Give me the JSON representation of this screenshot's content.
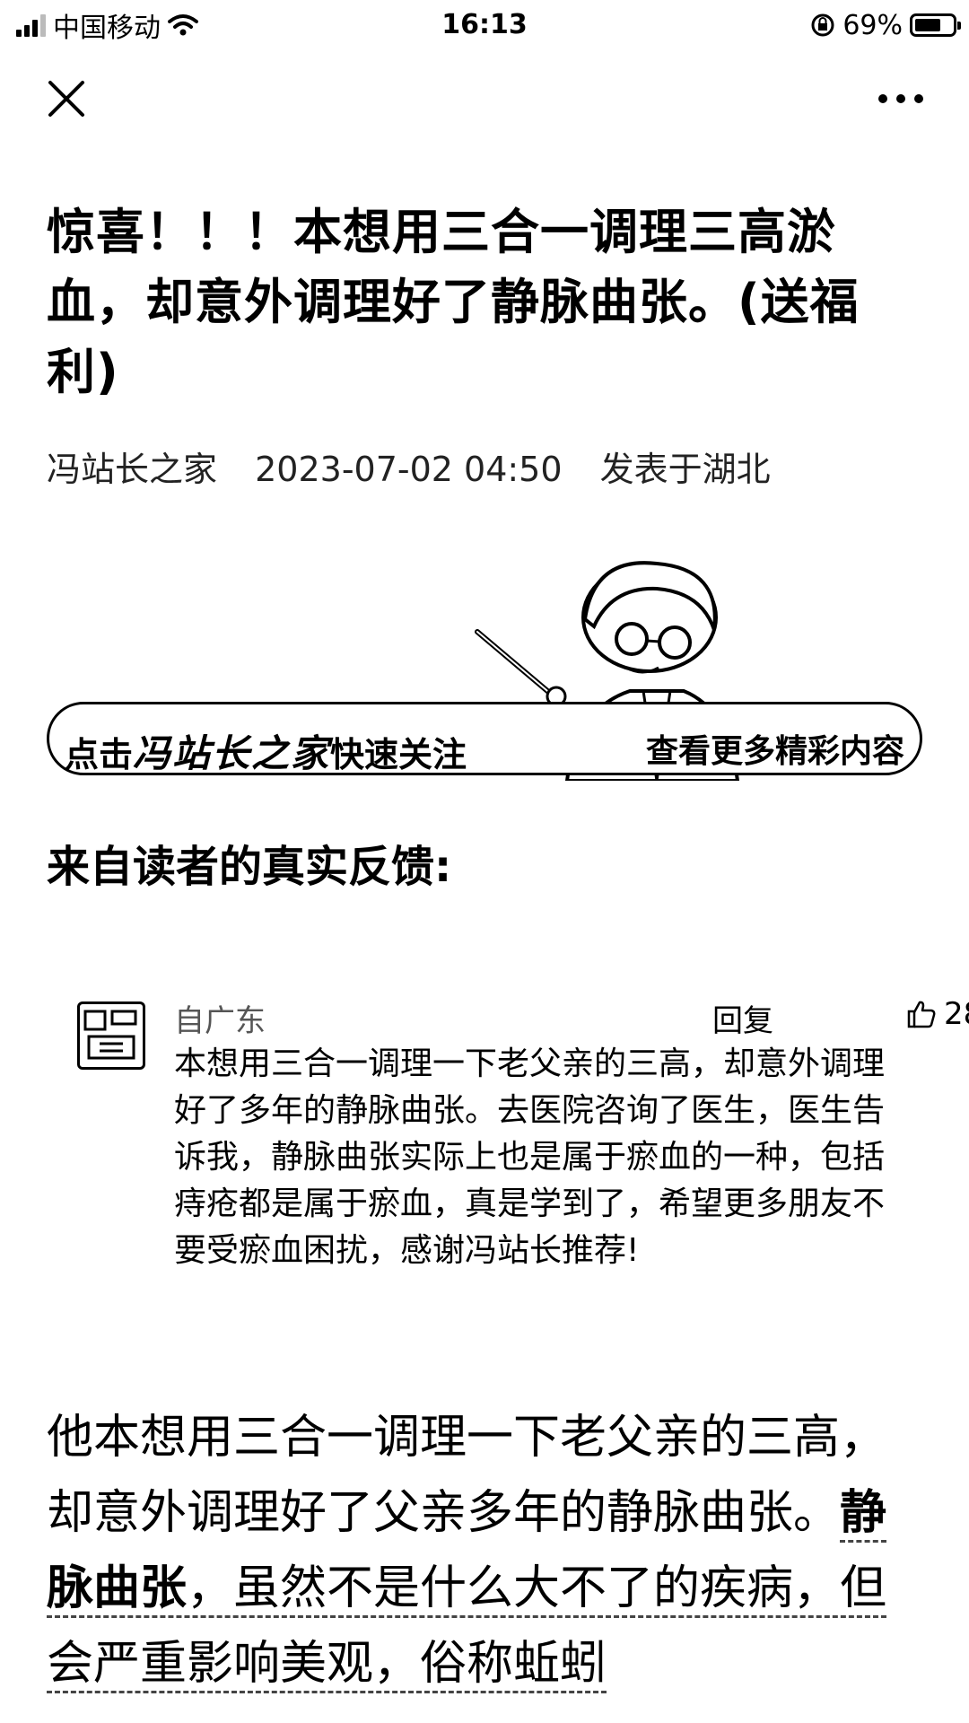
{
  "status_bar": {
    "carrier": "中国移动",
    "time": "16:13",
    "battery": "69%",
    "battery_level": 0.69
  },
  "nav": {
    "close_icon": "close-icon",
    "more_icon": "more-icon"
  },
  "article": {
    "title": "惊喜！！！本想用三合一调理三高淤血，却意外调理好了静脉曲张。(送福利)",
    "author": "冯站长之家",
    "datetime": "2023-07-02 04:50",
    "location": "发表于湖北"
  },
  "banner": {
    "left_prefix": "点击",
    "brand": "冯站长之家",
    "left_suffix": "快速关注",
    "right_text": "查看更多精彩内容"
  },
  "section_heading": "来自读者的真实反馈:",
  "comment": {
    "user_location": "自广东",
    "reply_label": "回复",
    "likes": "28",
    "text": "本想用三合一调理一下老父亲的三高，却意外调理好了多年的静脉曲张。去医院咨询了医生，医生告诉我，静脉曲张实际上也是属于瘀血的一种，包括痔疮都是属于瘀血，真是学到了，希望更多朋友不要受瘀血困扰，感谢冯站长推荐!"
  },
  "body": {
    "p1_start": "他本想用三合一调理一下老父亲的三高，却意外调理好了父亲多年的静脉曲张。",
    "p1_link": "静脉曲张",
    "p1_rest_a": "，虽然不是什么大不了的",
    "p1_rest_b": "疾病，但会严重影响美观，俗称蚯蚓"
  }
}
